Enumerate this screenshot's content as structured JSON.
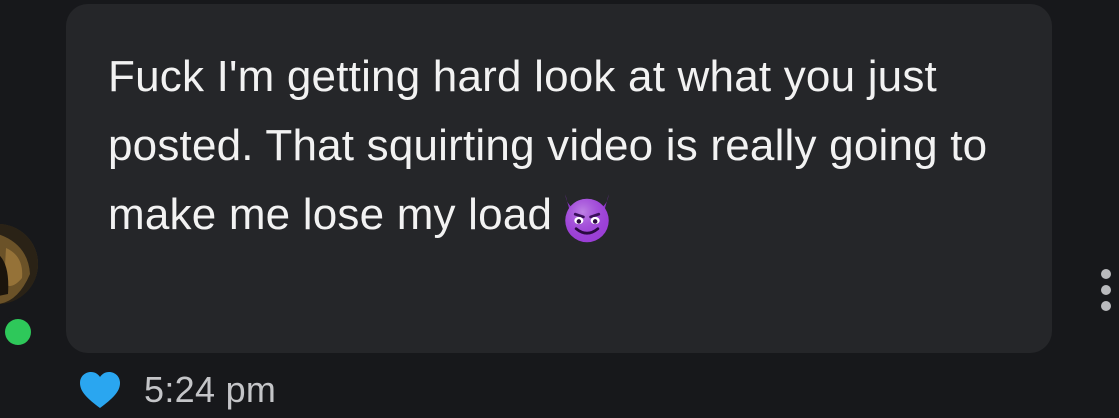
{
  "message": {
    "text": "Fuck I'm getting hard look at what you just posted. That squirting video is really going to make me lose my load",
    "emoji": "smiling-devil-emoji",
    "timestamp": "5:24 pm",
    "liked": true
  },
  "sender": {
    "online": true
  },
  "icons": {
    "heart": "heart-icon",
    "more": "more-vertical-icon"
  },
  "colors": {
    "background": "#17181b",
    "bubble": "#252629",
    "text": "#f2f2f2",
    "heart": "#2aa6f0",
    "online": "#2ec85a",
    "emoji": "#9b3fd6"
  }
}
